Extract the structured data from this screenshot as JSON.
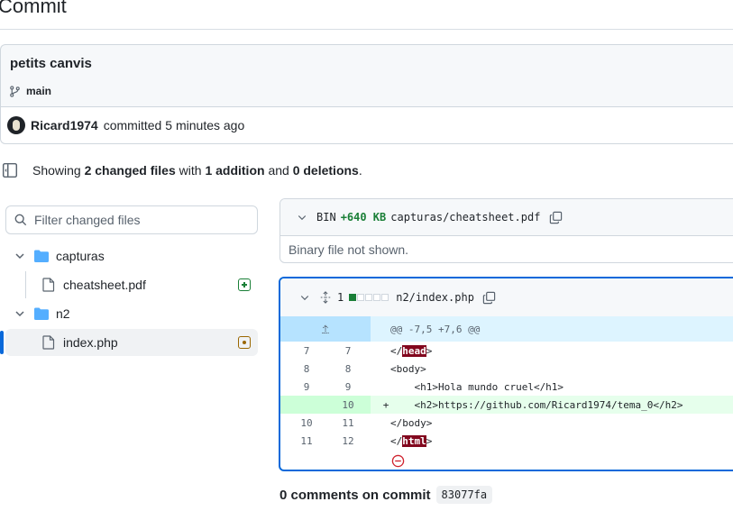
{
  "page": {
    "title": "Commit"
  },
  "commit": {
    "title": "petits canvis",
    "branch": "main",
    "author": "Ricard1974",
    "action": "committed",
    "time": "5 minutes ago"
  },
  "summary": {
    "prefix": "Showing",
    "files_changed": "2 changed files",
    "with": "with",
    "additions": "1 addition",
    "and": "and",
    "deletions": "0 deletions",
    "suffix": "."
  },
  "filter": {
    "placeholder": "Filter changed files"
  },
  "tree": {
    "folder1": "capturas",
    "file1": "cheatsheet.pdf",
    "folder2": "n2",
    "file2": "index.php"
  },
  "diff1": {
    "bin": "BIN",
    "size": "+640 KB",
    "path": "capturas/cheatsheet.pdf",
    "body": "Binary file not shown."
  },
  "diff2": {
    "count": "1",
    "path": "n2/index.php",
    "hunk": "@@ -7,5 +7,6 @@",
    "lines": [
      {
        "old": "7",
        "new": "7",
        "sign": "",
        "pre": "</",
        "hl": "head",
        "post": ">"
      },
      {
        "old": "8",
        "new": "8",
        "sign": "",
        "pre": "<body>",
        "hl": "",
        "post": ""
      },
      {
        "old": "9",
        "new": "9",
        "sign": "",
        "pre": "    <h1>Hola mundo cruel</h1>",
        "hl": "",
        "post": ""
      },
      {
        "old": "",
        "new": "10",
        "sign": "+",
        "pre": "    <h2>https://github.com/Ricard1974/tema_0</h2>",
        "hl": "",
        "post": ""
      },
      {
        "old": "10",
        "new": "11",
        "sign": "",
        "pre": "</body>",
        "hl": "",
        "post": ""
      },
      {
        "old": "11",
        "new": "12",
        "sign": "",
        "pre": "</",
        "hl": "html",
        "post": ">"
      }
    ]
  },
  "comments": {
    "label": "0 comments on commit",
    "sha": "83077fa"
  },
  "colors": {
    "accent": "#0969da",
    "addition": "#1a7f37",
    "modified": "#9a6700",
    "highlight": "#82071e"
  }
}
